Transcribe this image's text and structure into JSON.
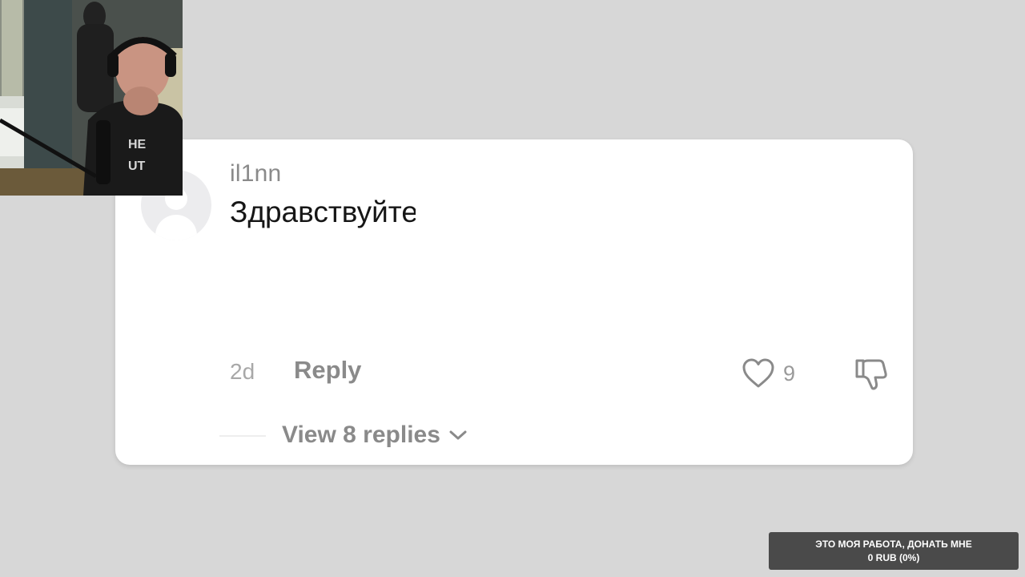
{
  "comment": {
    "username": "il1nn",
    "text": "Здравствуйте",
    "timestamp": "2d",
    "reply_label": "Reply",
    "like_count": "9",
    "view_replies_label": "View 8 replies"
  },
  "donation": {
    "line1": "ЭТО МОЯ РАБОТА, ДОНАТЬ МНЕ",
    "line2": "0 RUB (0%)"
  },
  "icons": {
    "like": "heart-outline-icon",
    "dislike": "thumbs-down-outline-icon",
    "expand": "chevron-down-icon",
    "avatar": "default-avatar-icon"
  },
  "colors": {
    "background": "#d7d7d7",
    "card": "#ffffff",
    "muted_text": "#8a8a8a",
    "primary_text": "#161616",
    "banner": "#4a4a4a"
  }
}
